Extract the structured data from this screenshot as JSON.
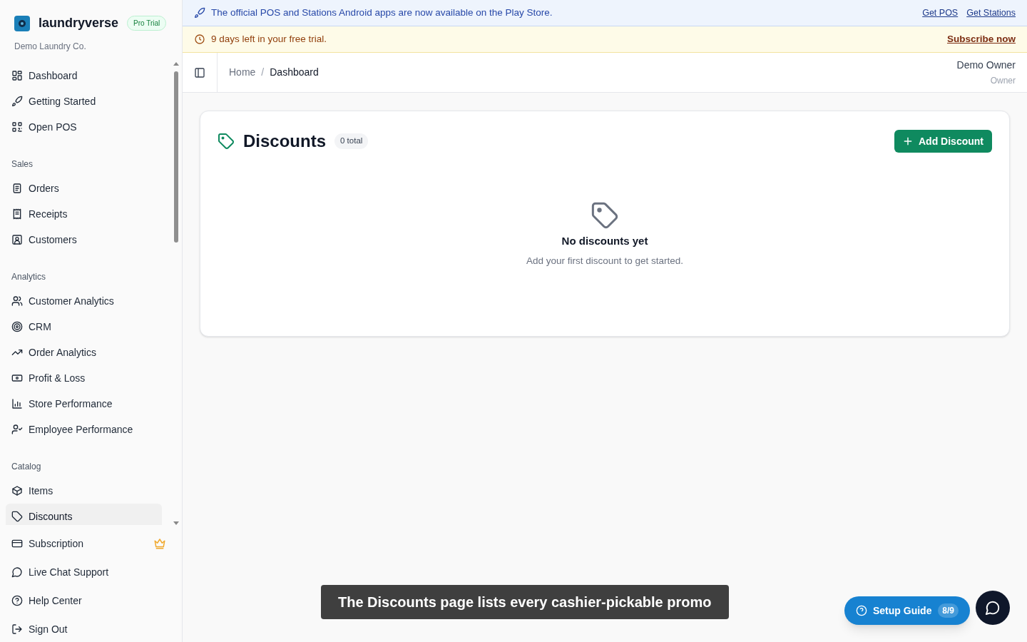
{
  "brand": {
    "name": "laundryverse",
    "badge": "Pro Trial",
    "company": "Demo Laundry Co."
  },
  "sidebar": {
    "sections": [
      {
        "items": [
          {
            "label": "Dashboard",
            "selected": false
          },
          {
            "label": "Getting Started",
            "selected": false
          },
          {
            "label": "Open POS",
            "selected": false
          }
        ]
      },
      {
        "label": "Sales",
        "items": [
          {
            "label": "Orders",
            "selected": false
          },
          {
            "label": "Receipts",
            "selected": false
          },
          {
            "label": "Customers",
            "selected": false
          }
        ]
      },
      {
        "label": "Analytics",
        "items": [
          {
            "label": "Customer Analytics",
            "selected": false
          },
          {
            "label": "CRM",
            "selected": false
          },
          {
            "label": "Order Analytics",
            "selected": false
          },
          {
            "label": "Profit & Loss",
            "selected": false
          },
          {
            "label": "Store Performance",
            "selected": false
          },
          {
            "label": "Employee Performance",
            "selected": false
          }
        ]
      },
      {
        "label": "Catalog",
        "items": [
          {
            "label": "Items",
            "selected": false
          },
          {
            "label": "Discounts",
            "selected": true
          }
        ]
      }
    ],
    "footer": [
      {
        "label": "Subscription",
        "premium": true
      },
      {
        "label": "Live Chat Support",
        "premium": false
      },
      {
        "label": "Help Center",
        "premium": false
      },
      {
        "label": "Sign Out",
        "premium": false
      }
    ]
  },
  "announcement": {
    "text": "The official POS and Stations Android apps are now available on the Play Store.",
    "links": [
      "Get POS",
      "Get Stations"
    ]
  },
  "trial_banner": {
    "text": "9 days left in your free trial.",
    "link": "Subscribe now"
  },
  "breadcrumb": {
    "separator": "/",
    "items": [
      "Home",
      "Dashboard"
    ]
  },
  "user": {
    "name": "Demo Owner",
    "role": "Owner"
  },
  "page": {
    "title": "Discounts",
    "count": "0 total",
    "add_button": "Add Discount",
    "empty_title": "No discounts yet",
    "empty_text": "Add your first discount to get started."
  },
  "caption": "The Discounts page lists every cashier-pickable promo",
  "setup_guide": {
    "label": "Setup Guide",
    "progress": "8/9"
  }
}
